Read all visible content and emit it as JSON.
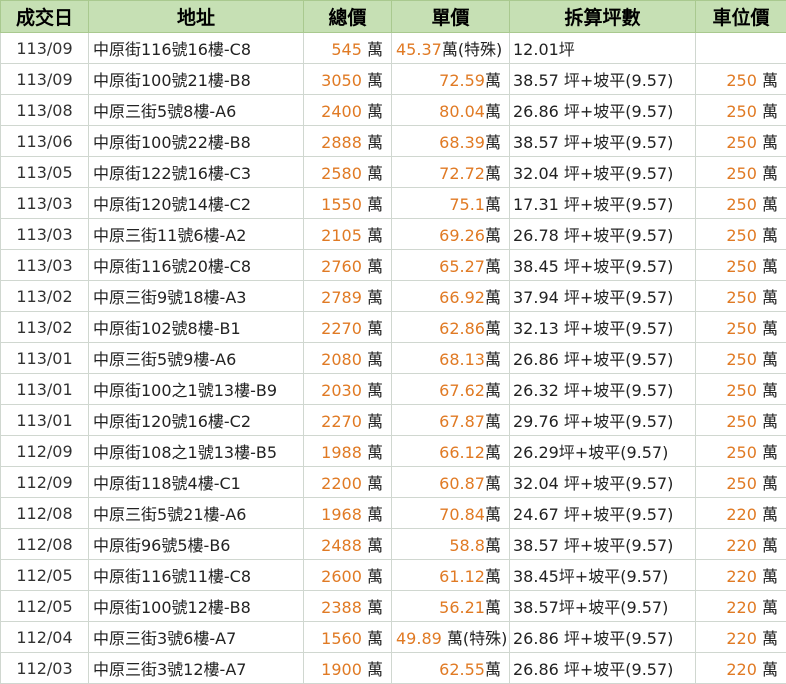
{
  "headers": [
    "成交日",
    "地址",
    "總價",
    "單價",
    "拆算坪數",
    "車位價"
  ],
  "rows": [
    {
      "date": "113/09",
      "address": "中原街116號16樓-C8",
      "total": "545",
      "unit": "45.37",
      "unit_note": "萬(特殊)",
      "area": "12.01坪",
      "parking": "",
      "parking_unit": ""
    },
    {
      "date": "113/09",
      "address": "中原街100號21樓-B8",
      "total": "3050",
      "unit": "72.59",
      "unit_note": "萬",
      "area": "38.57 坪+坡平(9.57)",
      "parking": "250",
      "parking_unit": "萬"
    },
    {
      "date": "113/08",
      "address": "中原三街5號8樓-A6",
      "total": "2400",
      "unit": "80.04",
      "unit_note": "萬",
      "area": "26.86 坪+坡平(9.57)",
      "parking": "250",
      "parking_unit": "萬"
    },
    {
      "date": "113/06",
      "address": "中原街100號22樓-B8",
      "total": "2888",
      "unit": "68.39",
      "unit_note": "萬",
      "area": "38.57 坪+坡平(9.57)",
      "parking": "250",
      "parking_unit": "萬"
    },
    {
      "date": "113/05",
      "address": "中原街122號16樓-C3",
      "total": "2580",
      "unit": "72.72",
      "unit_note": "萬",
      "area": "32.04 坪+坡平(9.57)",
      "parking": "250",
      "parking_unit": "萬"
    },
    {
      "date": "113/03",
      "address": "中原街120號14樓-C2",
      "total": "1550",
      "unit": "75.1",
      "unit_note": "萬",
      "area": "17.31 坪+坡平(9.57)",
      "parking": "250",
      "parking_unit": "萬"
    },
    {
      "date": "113/03",
      "address": "中原三街11號6樓-A2",
      "total": "2105",
      "unit": "69.26",
      "unit_note": "萬",
      "area": "26.78 坪+坡平(9.57)",
      "parking": "250",
      "parking_unit": "萬"
    },
    {
      "date": "113/03",
      "address": "中原街116號20樓-C8",
      "total": "2760",
      "unit": "65.27",
      "unit_note": "萬",
      "area": "38.45 坪+坡平(9.57)",
      "parking": "250",
      "parking_unit": "萬"
    },
    {
      "date": "113/02",
      "address": "中原三街9號18樓-A3",
      "total": "2789",
      "unit": "66.92",
      "unit_note": "萬",
      "area": "37.94 坪+坡平(9.57)",
      "parking": "250",
      "parking_unit": "萬"
    },
    {
      "date": "113/02",
      "address": "中原街102號8樓-B1",
      "total": "2270",
      "unit": "62.86",
      "unit_note": "萬",
      "area": "32.13 坪+坡平(9.57)",
      "parking": "250",
      "parking_unit": "萬"
    },
    {
      "date": "113/01",
      "address": "中原三街5號9樓-A6",
      "total": "2080",
      "unit": "68.13",
      "unit_note": "萬",
      "area": "26.86 坪+坡平(9.57)",
      "parking": "250",
      "parking_unit": "萬"
    },
    {
      "date": "113/01",
      "address": "中原街100之1號13樓-B9",
      "total": "2030",
      "unit": "67.62",
      "unit_note": "萬",
      "area": "26.32 坪+坡平(9.57)",
      "parking": "250",
      "parking_unit": "萬"
    },
    {
      "date": "113/01",
      "address": "中原街120號16樓-C2",
      "total": "2270",
      "unit": "67.87",
      "unit_note": "萬",
      "area": "29.76 坪+坡平(9.57)",
      "parking": "250",
      "parking_unit": "萬"
    },
    {
      "date": "112/09",
      "address": "中原街108之1號13樓-B5",
      "total": "1988",
      "unit": "66.12",
      "unit_note": "萬",
      "area": "26.29坪+坡平(9.57)",
      "parking": "250",
      "parking_unit": "萬"
    },
    {
      "date": "112/09",
      "address": "中原街118號4樓-C1",
      "total": "2200",
      "unit": "60.87",
      "unit_note": "萬",
      "area": "32.04 坪+坡平(9.57)",
      "parking": "250",
      "parking_unit": "萬"
    },
    {
      "date": "112/08",
      "address": "中原三街5號21樓-A6",
      "total": "1968",
      "unit": "70.84",
      "unit_note": "萬",
      "area": "24.67 坪+坡平(9.57)",
      "parking": "220",
      "parking_unit": "萬"
    },
    {
      "date": "112/08",
      "address": "中原街96號5樓-B6",
      "total": "2488",
      "unit": "58.8",
      "unit_note": "萬",
      "area": "38.57 坪+坡平(9.57)",
      "parking": "220",
      "parking_unit": "萬"
    },
    {
      "date": "112/05",
      "address": "中原街116號11樓-C8",
      "total": "2600",
      "unit": "61.12",
      "unit_note": "萬",
      "area": "38.45坪+坡平(9.57)",
      "parking": "220",
      "parking_unit": "萬"
    },
    {
      "date": "112/05",
      "address": "中原街100號12樓-B8",
      "total": "2388",
      "unit": "56.21",
      "unit_note": "萬",
      "area": "38.57坪+坡平(9.57)",
      "parking": "220",
      "parking_unit": "萬"
    },
    {
      "date": "112/04",
      "address": "中原三街3號6樓-A7",
      "total": "1560",
      "unit": "49.89",
      "unit_note": " 萬(特殊)",
      "area": "26.86 坪+坡平(9.57)",
      "parking": "220",
      "parking_unit": "萬"
    },
    {
      "date": "112/03",
      "address": "中原三街3號12樓-A7",
      "total": "1900",
      "unit": "62.55",
      "unit_note": "萬",
      "area": "26.86 坪+坡平(9.57)",
      "parking": "220",
      "parking_unit": "萬"
    }
  ],
  "total_unit": "萬",
  "colors": {
    "header_bg": "#c6e0b4",
    "number": "#e07a24",
    "grid": "#d0d7d0"
  }
}
